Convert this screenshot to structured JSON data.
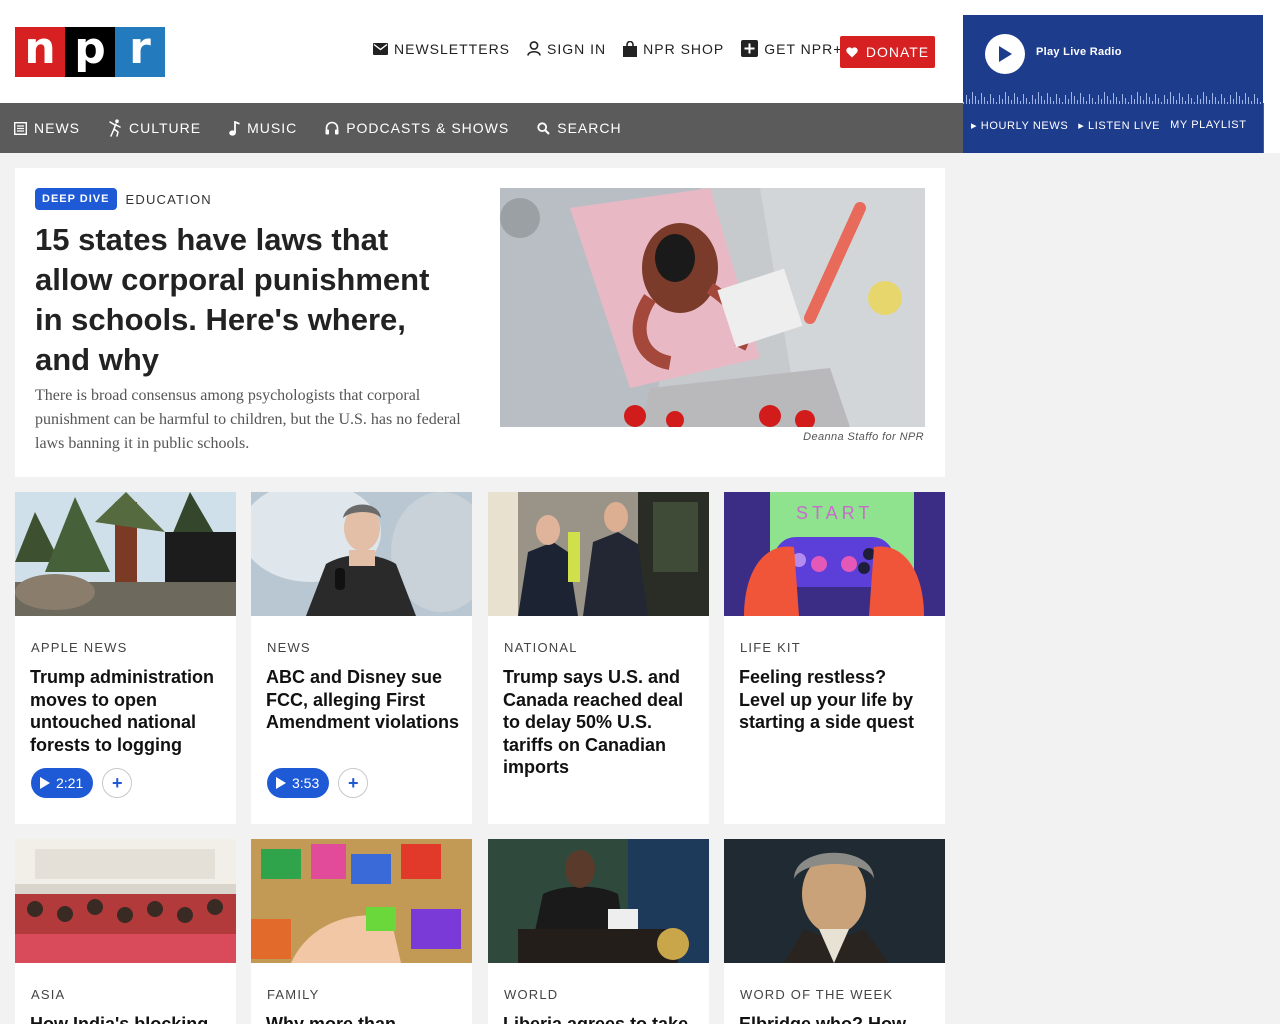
{
  "header": {
    "logo_letters": [
      "n",
      "p",
      "r"
    ],
    "utility": [
      {
        "icon": "envelope-icon",
        "label": "Newsletters"
      },
      {
        "icon": "user-icon",
        "label": "Sign In"
      },
      {
        "icon": "shopping-bag-icon",
        "label": "NPR Shop"
      },
      {
        "icon": "plus-square-icon",
        "label": "Get NPR+"
      }
    ],
    "donate": {
      "icon": "heart-icon",
      "label": "Donate"
    }
  },
  "nav": {
    "items": [
      {
        "icon": "newspaper-icon",
        "label": "News"
      },
      {
        "icon": "dancer-icon",
        "label": "Culture"
      },
      {
        "icon": "music-note-icon",
        "label": "Music"
      },
      {
        "icon": "headphones-icon",
        "label": "Podcasts & Shows"
      },
      {
        "icon": "search-icon",
        "label": "Search"
      }
    ]
  },
  "player": {
    "play_label": "Play Live Radio",
    "links": [
      "Hourly News",
      "Listen Live",
      "My Playlist"
    ]
  },
  "featured": {
    "badge": "Deep Dive",
    "slug": "Education",
    "title": "15 states have laws that allow corporal punishment in schools. Here's where, and why",
    "teaser": "There is broad consensus among psychologists that corporal punishment can be harmful to children, but the U.S. has no federal laws banning it in public schools.",
    "credit": "Deanna Staffo for NPR"
  },
  "cards": [
    {
      "slug": "Apple News",
      "title": "Trump administration moves to open untouched national forests to logging",
      "duration": "2:21"
    },
    {
      "slug": "News",
      "title": "ABC and Disney sue FCC, alleging First Amendment violations",
      "duration": "3:53"
    },
    {
      "slug": "National",
      "title": "Trump says U.S. and Canada reached deal to delay 50% U.S. tariffs on Canadian imports"
    },
    {
      "slug": "Life Kit",
      "title": "Feeling restless? Level up your life by starting a side quest",
      "image_text": "START"
    },
    {
      "slug": "Asia",
      "title": "How India's blocking"
    },
    {
      "slug": "Family",
      "title": "Why more than"
    },
    {
      "slug": "World",
      "title": "Liberia agrees to take"
    },
    {
      "slug": "Word of the Week",
      "title": "Elbridge who? How"
    }
  ],
  "colors": {
    "npr_red": "#d62021",
    "npr_blue": "#237bbd",
    "nav_gray": "#5b5b5b",
    "player_navy": "#1e3c8c",
    "accent_blue": "#1e5ad6"
  }
}
